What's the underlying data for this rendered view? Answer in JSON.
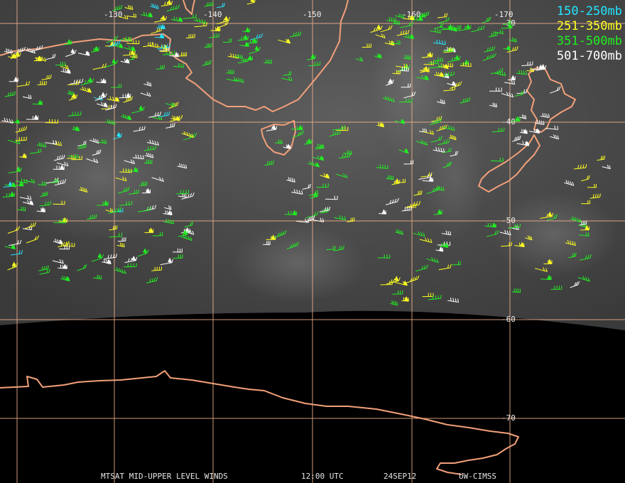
{
  "legend": {
    "items": [
      {
        "label": "150-250mb",
        "color": "#22e6ff"
      },
      {
        "label": "251-350mb",
        "color": "#ffff22"
      },
      {
        "label": "351-500mb",
        "color": "#22ee22"
      },
      {
        "label": "501-700mb",
        "color": "#ffffff"
      }
    ]
  },
  "grid": {
    "lon_labels": [
      "-130",
      "-140",
      "-150",
      "-160",
      "-170"
    ],
    "lat_labels": [
      "-30",
      "-40",
      "-50",
      "-60",
      "-70"
    ],
    "line_color": "#f4b48c"
  },
  "footer": {
    "product": "MTSAT MID-UPPER LEVEL WINDS",
    "time": "12:00 UTC",
    "date": "24SEP12",
    "source": "UW-CIMSS"
  },
  "colors": {
    "coastline": "#f2a07a",
    "background": "#000000",
    "imagery": "#5a5a5a"
  }
}
